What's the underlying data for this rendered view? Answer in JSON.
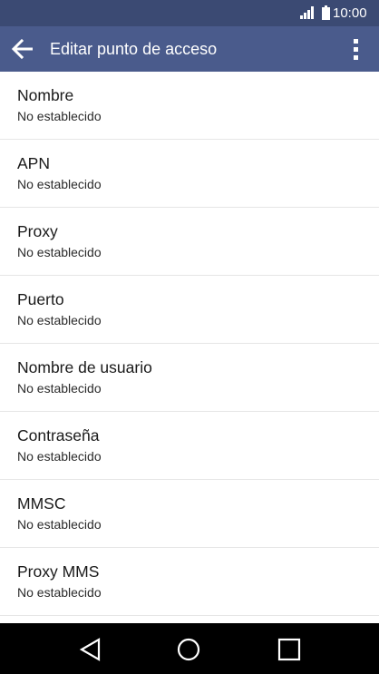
{
  "colors": {
    "status_bar": "#3b4a73",
    "app_bar": "#4a5b8c",
    "list_background": "#ffffff",
    "divider": "#e6e6e6",
    "nav_bar": "#000000"
  },
  "status_bar": {
    "time": "10:00",
    "signal_icon": "signal-icon",
    "battery_icon": "battery-icon"
  },
  "app_bar": {
    "title": "Editar punto de acceso",
    "back_icon": "arrow-back-icon",
    "menu_icon": "overflow-menu-icon"
  },
  "settings": [
    {
      "label": "Nombre",
      "summary": "No establecido"
    },
    {
      "label": "APN",
      "summary": "No establecido"
    },
    {
      "label": "Proxy",
      "summary": "No establecido"
    },
    {
      "label": "Puerto",
      "summary": "No establecido"
    },
    {
      "label": "Nombre de usuario",
      "summary": "No establecido"
    },
    {
      "label": "Contraseña",
      "summary": "No establecido"
    },
    {
      "label": "MMSC",
      "summary": "No establecido"
    },
    {
      "label": "Proxy MMS",
      "summary": "No establecido"
    }
  ],
  "nav_bar": {
    "back_icon": "nav-back-icon",
    "home_icon": "nav-home-icon",
    "recents_icon": "nav-recents-icon"
  }
}
